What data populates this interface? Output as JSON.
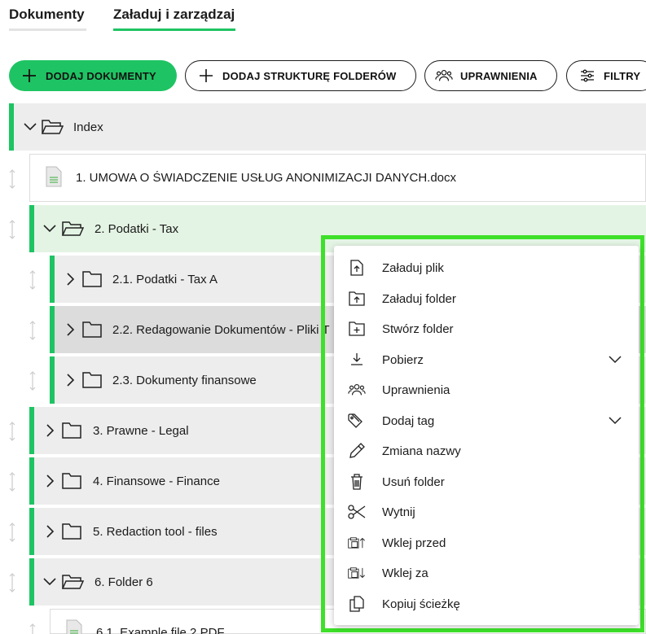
{
  "tabs": [
    {
      "label": "Dokumenty",
      "active": false
    },
    {
      "label": "Załaduj i zarządzaj",
      "active": true
    }
  ],
  "toolbar": {
    "add_documents": "DODAJ DOKUMENTY",
    "add_folder_structure": "DODAJ STRUKTURĘ FOLDERÓW",
    "permissions": "UPRAWNIENIA",
    "filters": "FILTRY"
  },
  "tree": {
    "root": "Index",
    "items": [
      {
        "label": "1. UMOWA O ŚWIADCZENIE USŁUG ANONIMIZACJI DANYCH.docx",
        "icon": "document-icon"
      },
      {
        "label": "2. Podatki - Tax",
        "icon": "folder-open-icon",
        "expanded": true
      },
      {
        "label": "2.1. Podatki - Tax A",
        "icon": "folder-icon"
      },
      {
        "label": "2.2. Redagowanie Dokumentów - Pliki T",
        "icon": "folder-icon"
      },
      {
        "label": "2.3. Dokumenty finansowe",
        "icon": "folder-icon"
      },
      {
        "label": "3. Prawne - Legal",
        "icon": "folder-icon"
      },
      {
        "label": "4. Finansowe - Finance",
        "icon": "folder-icon"
      },
      {
        "label": "5. Redaction tool - files",
        "icon": "folder-icon"
      },
      {
        "label": "6. Folder 6",
        "icon": "folder-open-icon",
        "expanded": true
      },
      {
        "label": "6.1. Example file 2.PDF",
        "icon": "document-icon"
      }
    ]
  },
  "context_menu": {
    "items": [
      {
        "label": "Załaduj plik",
        "icon": "upload-file-icon"
      },
      {
        "label": "Załaduj folder",
        "icon": "upload-folder-icon"
      },
      {
        "label": "Stwórz folder",
        "icon": "create-folder-icon"
      },
      {
        "label": "Pobierz",
        "icon": "download-icon",
        "submenu": true
      },
      {
        "label": "Uprawnienia",
        "icon": "users-icon"
      },
      {
        "label": "Dodaj tag",
        "icon": "tag-icon",
        "submenu": true
      },
      {
        "label": "Zmiana nazwy",
        "icon": "pencil-icon"
      },
      {
        "label": "Usuń folder",
        "icon": "trash-icon"
      },
      {
        "label": "Wytnij",
        "icon": "scissors-icon"
      },
      {
        "label": "Wklej przed",
        "icon": "paste-before-icon"
      },
      {
        "label": "Wklej za",
        "icon": "paste-after-icon"
      },
      {
        "label": "Kopiuj ścieżkę",
        "icon": "copy-path-icon"
      }
    ]
  },
  "colors": {
    "accent": "#1ec463",
    "highlight": "#3ee02a",
    "selected_row": "#e4f4e4"
  }
}
